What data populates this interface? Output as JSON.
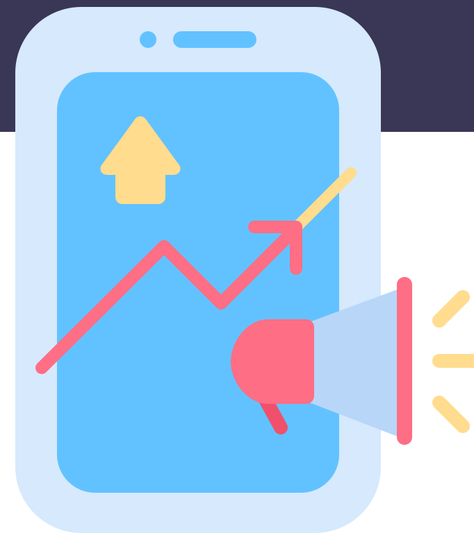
{
  "colors": {
    "banner": "#393755",
    "page_background": "#ffffff",
    "phone_body": "#D6E9FD",
    "phone_screen": "#62C2FF",
    "speaker_dot": "#62C2FF",
    "speaker_slot": "#62C2FF",
    "up_arrow": "#FFDC8E",
    "trend_line": "#FE6E85",
    "trend_extension": "#FFDC8E",
    "megaphone_body": "#FE6E85",
    "megaphone_cone": "#B8D6F8",
    "megaphone_rim": "#FE6E85",
    "megaphone_handle": "#F0506B",
    "sound_waves": "#FFDC8E"
  },
  "icons": {
    "phone": "smartphone-icon",
    "growth_arrow": "up-arrow-icon",
    "trend": "trending-up-icon",
    "megaphone": "megaphone-icon",
    "sound_waves": "sound-waves-icon"
  }
}
